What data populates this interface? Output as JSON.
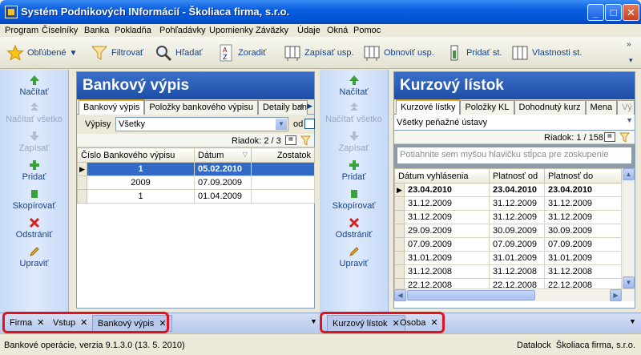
{
  "window": {
    "title": "Systém Podnikových INformácií - Školiaca firma, s.r.o.",
    "controls": {
      "minimize": "_",
      "maximize": "□",
      "close": "✕"
    }
  },
  "menu": [
    "Program",
    "Číselníky",
    "Banka",
    "Pokladňa",
    "Pohľadávky",
    "Upomienky",
    "Záväzky",
    "Údaje",
    "Okná",
    "Pomoc"
  ],
  "toolbar": {
    "favorites": "Obľúbené",
    "filter": "Filtrovať",
    "search": "Hľadať",
    "sort": "Zoradiť",
    "save_layout": "Zapísať usp.",
    "refresh_layout": "Obnoviť usp.",
    "add_column": "Pridať st.",
    "column_props": "Vlastnosti st.",
    "overflow": "»"
  },
  "actions": {
    "load": "Načítať",
    "load_all": "Načítať všetko",
    "save": "Zapísať",
    "add": "Pridať",
    "copy": "Skopírovať",
    "delete": "Odstrániť",
    "edit": "Upraviť"
  },
  "left": {
    "header": "Bankový výpis",
    "tabs": [
      "Bankový výpis",
      "Položky bankového výpisu",
      "Detaily bank"
    ],
    "filter_label": "Výpisy",
    "filter_value": "Všetky",
    "od_label": "od",
    "row_counter": "Riadok: 2 / 3",
    "columns": [
      "Číslo Bankového výpisu",
      "Dátum",
      "Zostatok"
    ],
    "rows": [
      {
        "num": "1",
        "date": "05.02.2010",
        "balance": "",
        "selected": true
      },
      {
        "num": "2009",
        "date": "07.09.2009",
        "balance": ""
      },
      {
        "num": "1",
        "date": "01.04.2009",
        "balance": ""
      }
    ]
  },
  "right": {
    "header": "Kurzový lístok",
    "tabs": [
      "Kurzové lístky",
      "Položky KL",
      "Dohodnutý kurz",
      "Mena",
      "Vý"
    ],
    "filter_value": "Všetky peňažné ústavy",
    "row_counter": "Riadok: 1 / 158",
    "group_hint": "Potiahnite sem myšou hlavičku stĺpca pre zoskupenie",
    "columns": [
      "Dátum vyhlásenia",
      "Platnosť od",
      "Platnosť do"
    ],
    "rows": [
      {
        "d": "23.04.2010",
        "od": "23.04.2010",
        "do": "23.04.2010",
        "bold": true
      },
      {
        "d": "31.12.2009",
        "od": "31.12.2009",
        "do": "31.12.2009"
      },
      {
        "d": "31.12.2009",
        "od": "31.12.2009",
        "do": "31.12.2009"
      },
      {
        "d": "29.09.2009",
        "od": "30.09.2009",
        "do": "30.09.2009"
      },
      {
        "d": "07.09.2009",
        "od": "07.09.2009",
        "do": "07.09.2009"
      },
      {
        "d": "31.01.2009",
        "od": "31.01.2009",
        "do": "31.01.2009"
      },
      {
        "d": "31.12.2008",
        "od": "31.12.2008",
        "do": "31.12.2008"
      },
      {
        "d": "22.12.2008",
        "od": "22.12.2008",
        "do": "22.12.2008"
      }
    ]
  },
  "doc_tabs_left": [
    "Firma",
    "Vstup",
    "Bankový výpis"
  ],
  "doc_tabs_right": [
    "Kurzový lístok",
    "Osoba"
  ],
  "status": {
    "left": "Bankové operácie, verzia 9.1.3.0 (13. 5. 2010)",
    "right": "Datalock  Školiaca firma, s.r.o."
  },
  "colors": {
    "header_blue": "#1e4fa8",
    "selection": "#3169c6",
    "highlight_box": "#e0121e"
  }
}
